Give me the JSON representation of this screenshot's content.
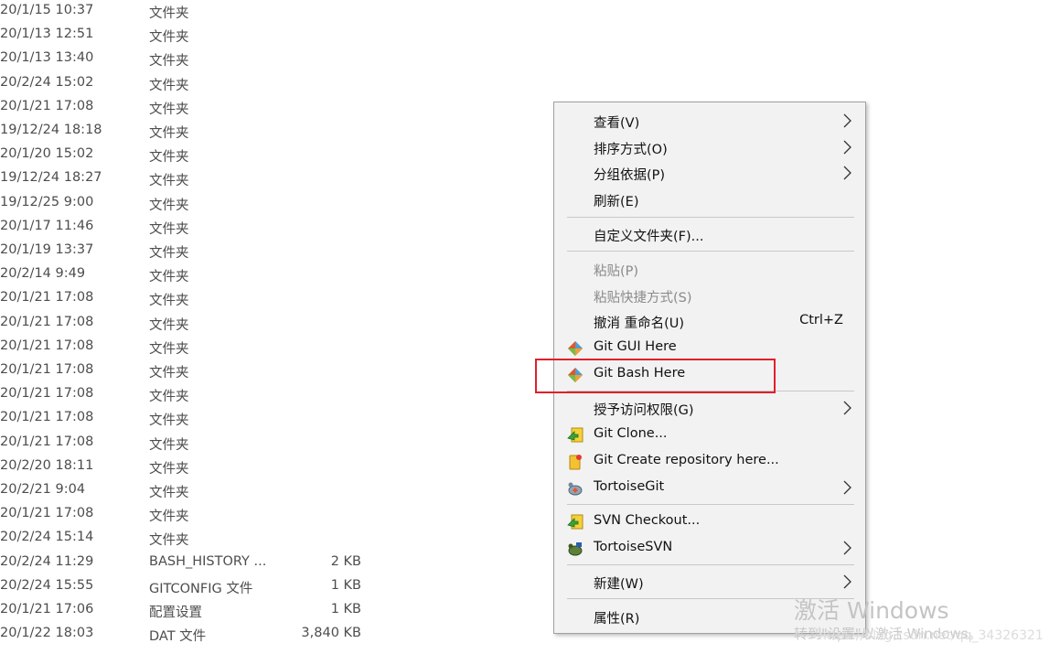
{
  "files": [
    {
      "date": "20/1/15 10:37",
      "type": "文件夹",
      "size": ""
    },
    {
      "date": "20/1/13 12:51",
      "type": "文件夹",
      "size": ""
    },
    {
      "date": "20/1/13 13:40",
      "type": "文件夹",
      "size": ""
    },
    {
      "date": "20/2/24 15:02",
      "type": "文件夹",
      "size": ""
    },
    {
      "date": "20/1/21 17:08",
      "type": "文件夹",
      "size": ""
    },
    {
      "date": "19/12/24 18:18",
      "type": "文件夹",
      "size": ""
    },
    {
      "date": "20/1/20 15:02",
      "type": "文件夹",
      "size": ""
    },
    {
      "date": "19/12/24 18:27",
      "type": "文件夹",
      "size": ""
    },
    {
      "date": "19/12/25 9:00",
      "type": "文件夹",
      "size": ""
    },
    {
      "date": "20/1/17 11:46",
      "type": "文件夹",
      "size": ""
    },
    {
      "date": "20/1/19 13:37",
      "type": "文件夹",
      "size": ""
    },
    {
      "date": "20/2/14 9:49",
      "type": "文件夹",
      "size": ""
    },
    {
      "date": "20/1/21 17:08",
      "type": "文件夹",
      "size": ""
    },
    {
      "date": "20/1/21 17:08",
      "type": "文件夹",
      "size": ""
    },
    {
      "date": "20/1/21 17:08",
      "type": "文件夹",
      "size": ""
    },
    {
      "date": "20/1/21 17:08",
      "type": "文件夹",
      "size": ""
    },
    {
      "date": "20/1/21 17:08",
      "type": "文件夹",
      "size": ""
    },
    {
      "date": "20/1/21 17:08",
      "type": "文件夹",
      "size": ""
    },
    {
      "date": "20/1/21 17:08",
      "type": "文件夹",
      "size": ""
    },
    {
      "date": "20/2/20 18:11",
      "type": "文件夹",
      "size": ""
    },
    {
      "date": "20/2/21 9:04",
      "type": "文件夹",
      "size": ""
    },
    {
      "date": "20/1/21 17:08",
      "type": "文件夹",
      "size": ""
    },
    {
      "date": "20/2/24 15:14",
      "type": "文件夹",
      "size": ""
    },
    {
      "date": "20/2/24 11:29",
      "type": "BASH_HISTORY ...",
      "size": "2 KB"
    },
    {
      "date": "20/2/24 15:55",
      "type": "GITCONFIG 文件",
      "size": "1 KB"
    },
    {
      "date": "20/1/21 17:06",
      "type": "配置设置",
      "size": "1 KB"
    },
    {
      "date": "20/1/22 18:03",
      "type": "DAT 文件",
      "size": "3,840 KB"
    }
  ],
  "menu": {
    "view": {
      "label": "查看(V)"
    },
    "sort_by": {
      "label": "排序方式(O)"
    },
    "group_by": {
      "label": "分组依据(P)"
    },
    "refresh": {
      "label": "刷新(E)"
    },
    "customize_folder": {
      "label": "自定义文件夹(F)..."
    },
    "paste": {
      "label": "粘贴(P)"
    },
    "paste_shortcut": {
      "label": "粘贴快捷方式(S)"
    },
    "undo_rename": {
      "label": "撤消 重命名(U)",
      "shortcut": "Ctrl+Z"
    },
    "git_gui": {
      "label": "Git GUI Here",
      "icon": "git-icon"
    },
    "git_bash": {
      "label": "Git Bash Here",
      "icon": "git-icon"
    },
    "grant_access": {
      "label": "授予访问权限(G)"
    },
    "git_clone": {
      "label": "Git Clone...",
      "icon": "tortoisegit-clone-icon"
    },
    "git_create_repo": {
      "label": "Git Create repository here...",
      "icon": "tortoisegit-repo-icon"
    },
    "tortoisegit": {
      "label": "TortoiseGit",
      "icon": "tortoisegit-icon"
    },
    "svn_checkout": {
      "label": "SVN Checkout...",
      "icon": "svn-checkout-icon"
    },
    "tortoisesvn": {
      "label": "TortoiseSVN",
      "icon": "tortoisesvn-icon"
    },
    "new": {
      "label": "新建(W)"
    },
    "properties": {
      "label": "属性(R)"
    }
  },
  "highlight_color": "#e0202a",
  "watermark": {
    "title": "激活 Windows",
    "subtitle": "转到\"设置\"以激活 Windows。",
    "url": "https://blog.csdn.net/qq_34326321"
  }
}
